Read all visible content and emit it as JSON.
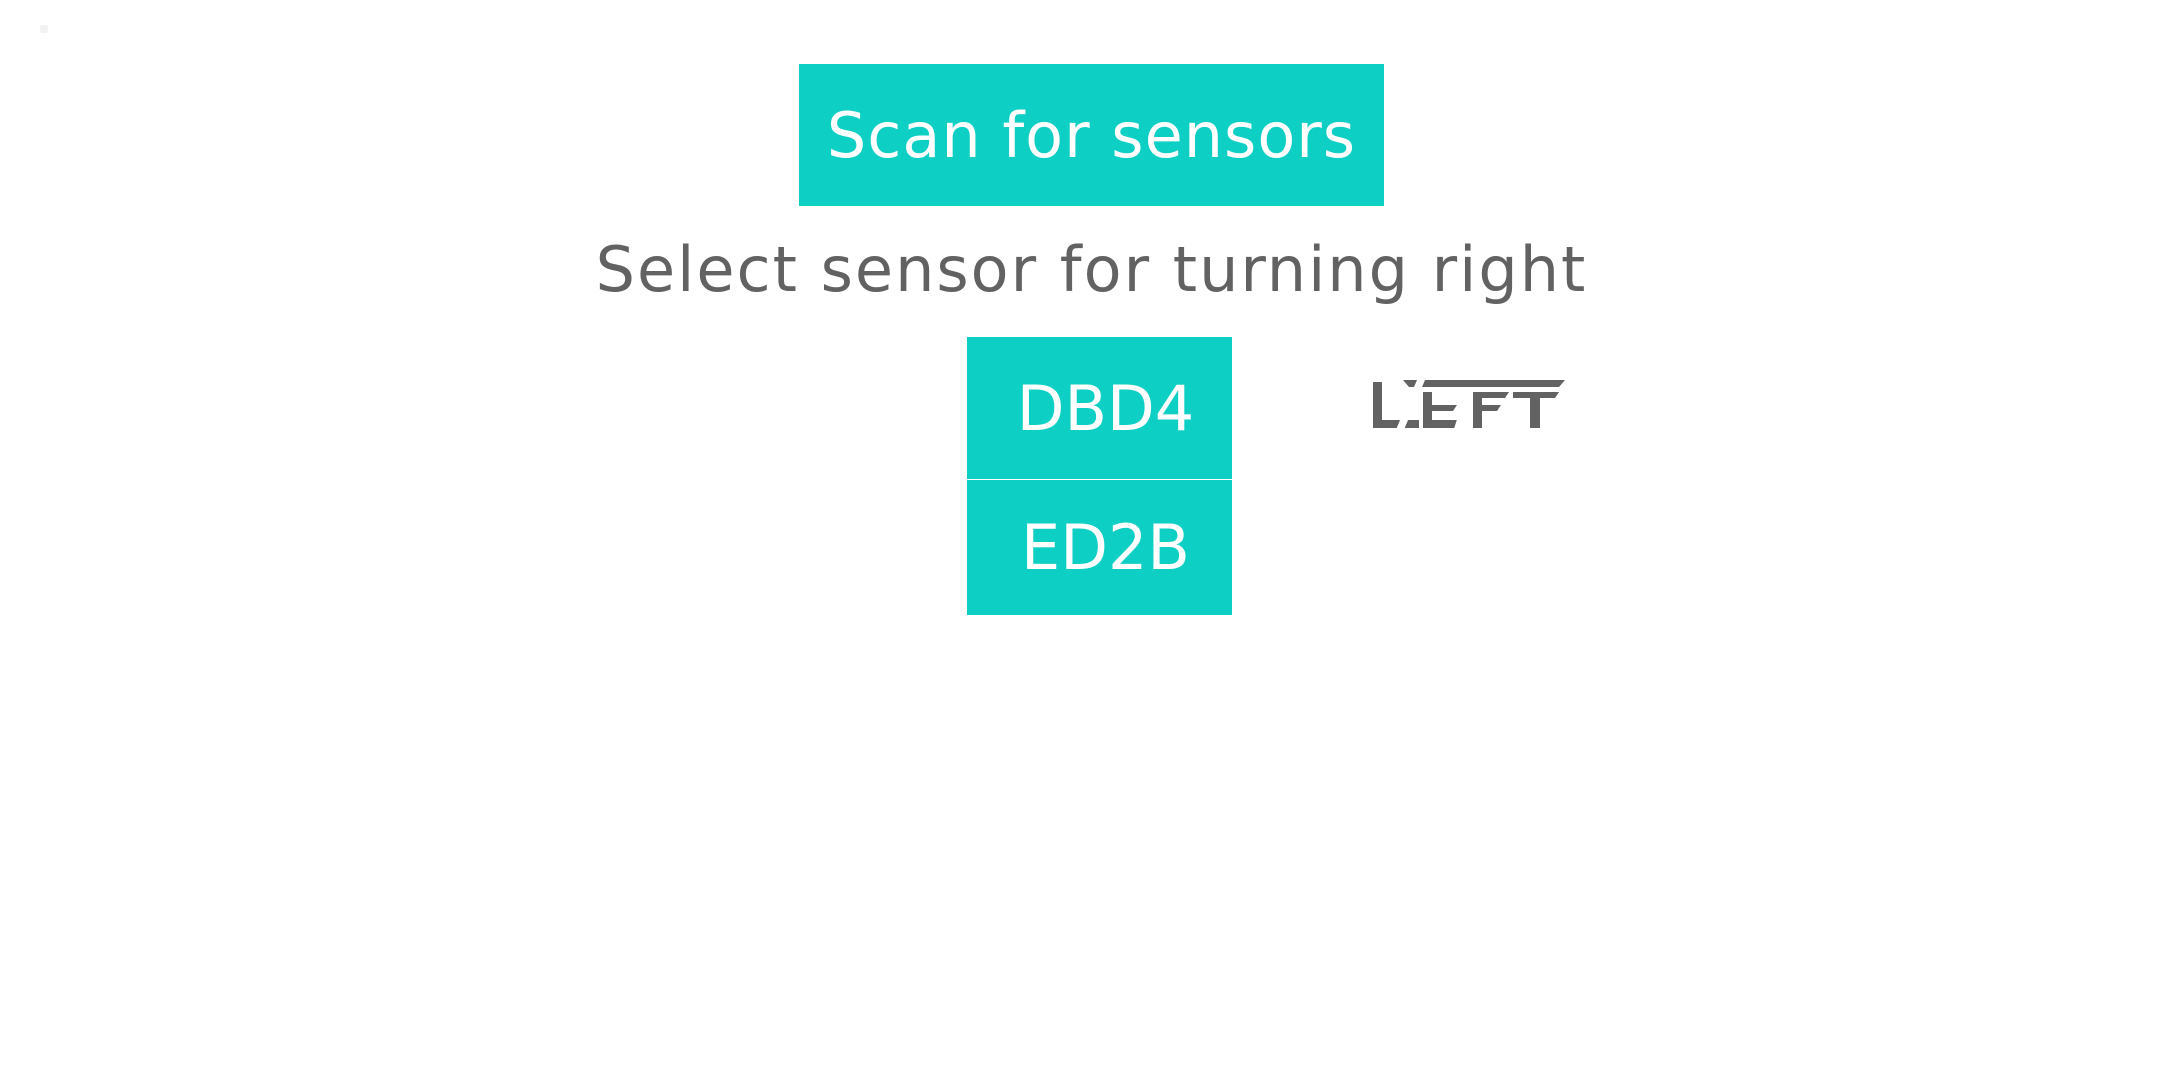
{
  "colors": {
    "accent": "#0ecfc4",
    "text": "#626262",
    "button_text": "#ffffff",
    "background": "#ffffff"
  },
  "scan_button": {
    "label": "Scan for sensors"
  },
  "prompt": {
    "text": "Select sensor for turning right"
  },
  "sensors": [
    {
      "label": "DBD4"
    },
    {
      "label": "ED2B"
    }
  ],
  "direction_logo": {
    "text": "LEFT",
    "icon": "left-direction-logo"
  }
}
